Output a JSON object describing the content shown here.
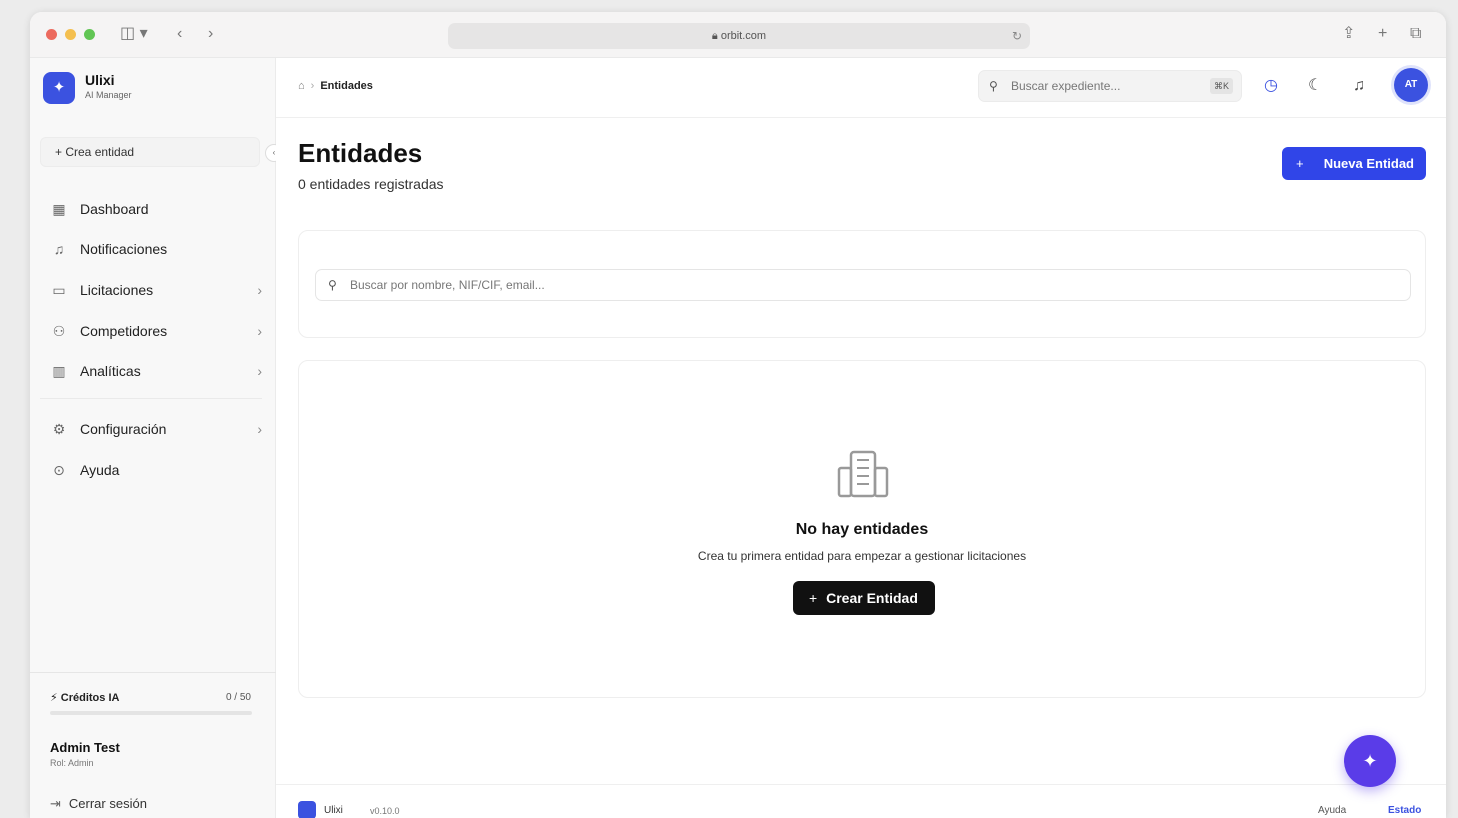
{
  "browser": {
    "url": "orbit.com",
    "colors": {
      "close": "#ec6a5e",
      "minimize": "#f4bf4f",
      "maximize": "#61c554"
    }
  },
  "sidebar": {
    "brand_name": "Ulixi",
    "brand_sub": "AI Manager",
    "create_entity": "Crea entidad",
    "items": [
      {
        "label": "Dashboard",
        "icon": "grid-icon",
        "chevron": false
      },
      {
        "label": "Notificaciones",
        "icon": "bell-icon",
        "chevron": false
      },
      {
        "label": "Licitaciones",
        "icon": "briefcase-icon",
        "chevron": true
      },
      {
        "label": "Competidores",
        "icon": "users-icon",
        "chevron": true
      },
      {
        "label": "Analíticas",
        "icon": "chart-icon",
        "chevron": true
      },
      {
        "label": "Configuración",
        "icon": "gear-icon",
        "chevron": true
      },
      {
        "label": "Ayuda",
        "icon": "help-icon",
        "chevron": false
      }
    ],
    "credits": {
      "label": "Créditos IA",
      "value": "0 / 50",
      "fraction": 0
    },
    "user": {
      "name": "Admin Test",
      "role": "Rol: Admin"
    },
    "logout": "Cerrar sesión"
  },
  "topbar": {
    "breadcrumb_current": "Entidades",
    "search_placeholder": "Buscar expediente...",
    "search_shortcut": "⌘K",
    "avatar_initials": "AT"
  },
  "page": {
    "title": "Entidades",
    "subtitle": "0 entidades registradas",
    "new_button": "Nueva Entidad",
    "filter_placeholder": "Buscar por nombre, NIF/CIF, email...",
    "empty_title": "No hay entidades",
    "empty_desc": "Crea tu primera entidad para empezar a gestionar licitaciones",
    "empty_button": "Crear Entidad"
  },
  "footer": {
    "name": "Ulixi",
    "version": "v0.10.0",
    "help": "Ayuda",
    "link": "Estado"
  },
  "colors": {
    "accent": "#3b52e0",
    "fab": "#5a3ce8"
  }
}
